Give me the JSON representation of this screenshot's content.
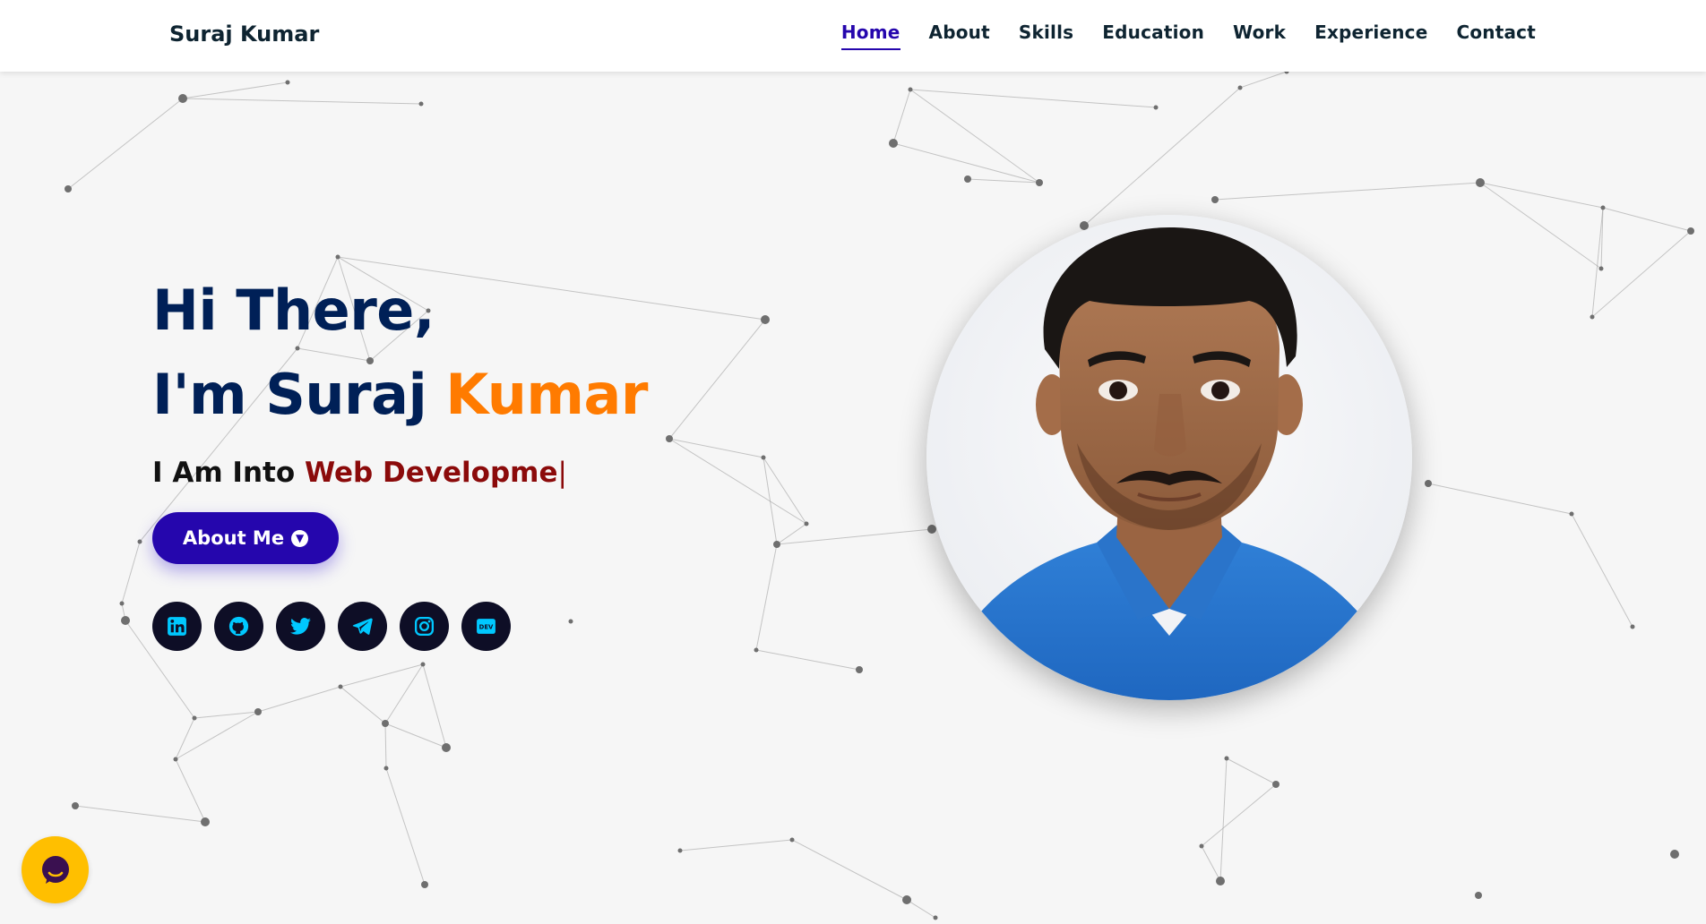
{
  "brand": {
    "name": "Suraj Kumar"
  },
  "nav": {
    "items": [
      {
        "label": "Home",
        "active": true
      },
      {
        "label": "About"
      },
      {
        "label": "Skills"
      },
      {
        "label": "Education"
      },
      {
        "label": "Work"
      },
      {
        "label": "Experience"
      },
      {
        "label": "Contact"
      }
    ]
  },
  "hero": {
    "greeting": "Hi There,",
    "intro_prefix": "I'm Suraj ",
    "intro_accent": "Kumar",
    "typing_prefix": "I Am Into ",
    "typing_text": "Web Developme",
    "typing_cursor": "|",
    "button_label": "About Me"
  },
  "socials": [
    {
      "icon": "linkedin-icon"
    },
    {
      "icon": "github-icon"
    },
    {
      "icon": "twitter-icon"
    },
    {
      "icon": "telegram-icon"
    },
    {
      "icon": "instagram-icon"
    },
    {
      "icon": "dev-icon",
      "text": "DEV"
    }
  ],
  "colors": {
    "accent": "#2506ad",
    "heading": "#002057",
    "highlight": "#ff7b00",
    "typed": "#8b0a0a",
    "social_bg": "#0e0e26",
    "social_icon": "#00c8ff",
    "chat": "#ffbf00"
  }
}
